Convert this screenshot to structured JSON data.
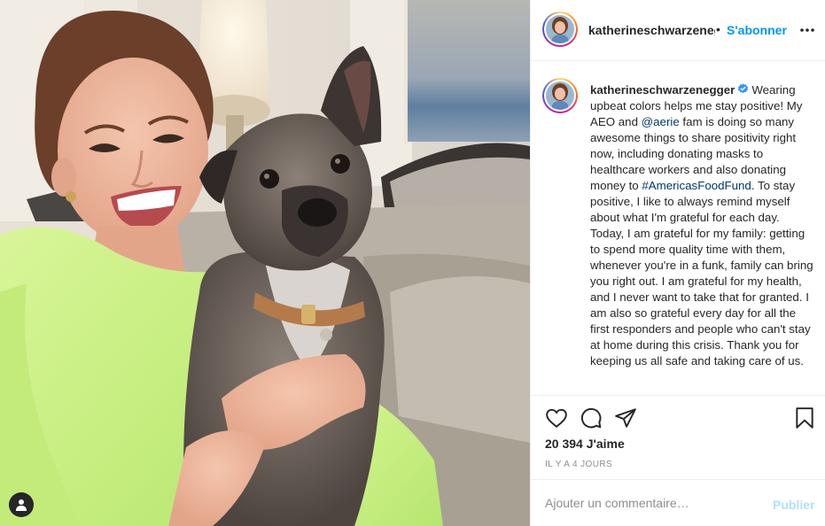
{
  "post": {
    "username": "katherineschwarzenegger",
    "header_username_display": "katherineschwarzenegg",
    "follow_separator": "•",
    "follow_label": "S'abonner",
    "caption_parts": {
      "text1": "Wearing upbeat colors helps me stay positive! My AEO and ",
      "mention": "@aerie",
      "text2": " fam is doing so many awesome things to share positivity right now, including donating masks to healthcare workers and also donating money to ",
      "hashtag": "#AmericasFoodFund",
      "text3": ". To stay positive, I like to always remind myself about what I'm grateful for each day. Today, I am grateful for my family: getting to spend more quality time with them, whenever you're in a funk, family can bring you right out. I am grateful for my health, and I never want to take that for granted. I am also so grateful every day for all the first responders and people who can't stay at home during this crisis. Thank you for keeping us all safe and taking care of us."
    },
    "likes_text": "20 394 J'aime",
    "time_text": "IL Y A 4 JOURS",
    "comment_placeholder": "Ajouter un commentaire…",
    "publish_label": "Publier"
  },
  "icons": {
    "header_more": "more-options-icon",
    "verified": "verified-badge-icon",
    "like": "heart-icon",
    "comment": "comment-bubble-icon",
    "share": "paper-plane-icon",
    "save": "bookmark-icon",
    "tag": "user-tag-icon"
  },
  "colors": {
    "link_blue": "#0095f6",
    "publish_disabled": "#b2dffc",
    "secondary_text": "#8e8e8e",
    "border": "#efefef"
  }
}
